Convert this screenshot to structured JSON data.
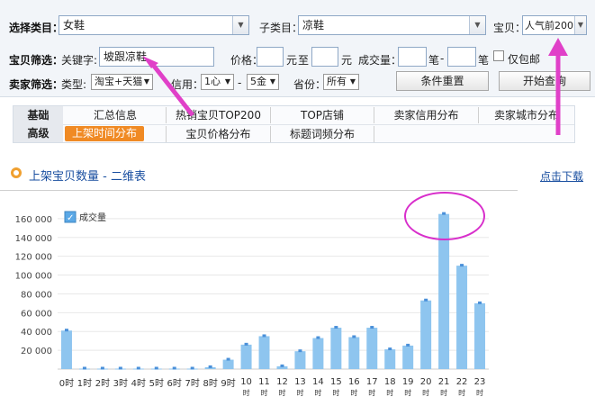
{
  "filter": {
    "category_label": "选择类目：",
    "category_value": "女鞋",
    "subcategory_label": "子类目：",
    "subcategory_value": "凉鞋",
    "item_label": "宝贝：",
    "item_value": "人气前200"
  },
  "item_filter": {
    "section_label": "宝贝筛选：",
    "keyword_label": "关键字:",
    "keyword_value": "坡跟凉鞋",
    "price_label": "价格：",
    "price_unit": "元",
    "to_label": "至",
    "price_unit2": "元",
    "volume_label": "成交量：",
    "volume_unit": "笔",
    "dash": "-",
    "volume_unit2": "笔",
    "free_shipping_label": "仅包邮"
  },
  "seller_filter": {
    "section_label": "卖家筛选：",
    "type_label": "类型:",
    "type_value": "淘宝+天猫",
    "credit_label": "信用：",
    "credit_from": "1心",
    "credit_dash": "-",
    "credit_to": "5金",
    "province_label": "省份：",
    "province_value": "所有",
    "reset_button": "条件重置",
    "start_button": "开始查询"
  },
  "tabs": {
    "basic_label": "基础",
    "advanced_label": "高级",
    "row1": [
      "汇总信息",
      "热销宝贝TOP200",
      "TOP店铺",
      "卖家信用分布",
      "卖家城市分布"
    ],
    "row2": [
      "上架时间分布",
      "宝贝价格分布",
      "标题词频分布"
    ]
  },
  "section": {
    "title": "上架宝贝数量 - 二维表",
    "download_link": "点击下载"
  },
  "colors": {
    "bar": "#8ec5ef",
    "active_tab": "#f08a24",
    "annotation": "#e040c8",
    "link": "#1a4fa0"
  },
  "chart_data": {
    "type": "bar",
    "legend": [
      "成交量"
    ],
    "categories": [
      "0时",
      "1时",
      "2时",
      "3时",
      "4时",
      "5时",
      "6时",
      "7时",
      "8时",
      "9时",
      "10时",
      "11时",
      "12时",
      "13时",
      "14时",
      "15时",
      "16时",
      "17时",
      "18时",
      "19时",
      "20时",
      "21时",
      "22时",
      "23时"
    ],
    "values": [
      41000,
      500,
      500,
      500,
      500,
      500,
      500,
      500,
      2000,
      10000,
      26000,
      35000,
      3000,
      19000,
      33000,
      44000,
      34000,
      44000,
      21000,
      25000,
      73000,
      165000,
      110000,
      70000
    ],
    "yticks": [
      "20 000",
      "40 000",
      "60 000",
      "80 000",
      "100 000",
      "120 000",
      "140 000",
      "160 000"
    ],
    "ylim": [
      0,
      180000
    ],
    "grid": true,
    "legend_position": "top-left"
  }
}
